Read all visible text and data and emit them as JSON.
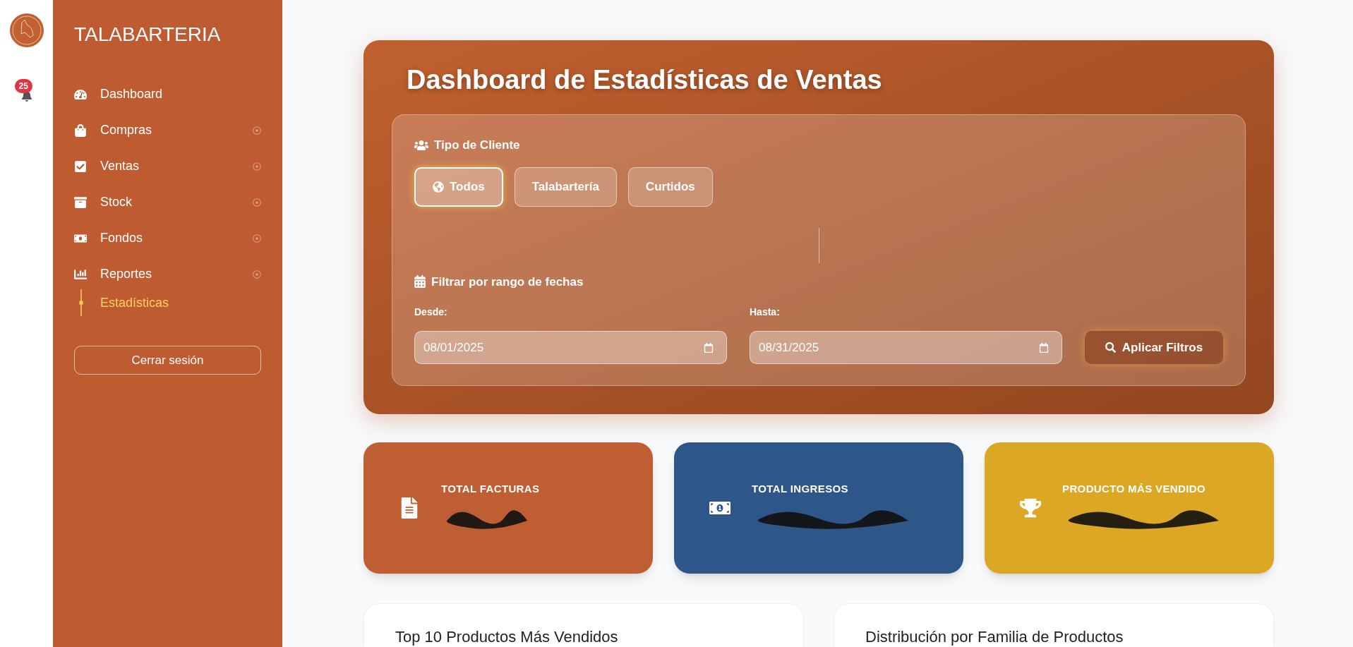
{
  "rail": {
    "notification_count": "25"
  },
  "sidebar": {
    "title": "TALABARTERIA",
    "items": [
      {
        "label": "Dashboard",
        "kind": "link",
        "selected": false
      },
      {
        "label": "Compras",
        "kind": "menu",
        "selected": false
      },
      {
        "label": "Ventas",
        "kind": "menu",
        "selected": false
      },
      {
        "label": "Stock",
        "kind": "menu",
        "selected": false
      },
      {
        "label": "Fondos",
        "kind": "menu",
        "selected": false
      },
      {
        "label": "Reportes",
        "kind": "menu",
        "selected": false,
        "children": [
          {
            "label": "Estadísticas",
            "selected": true
          }
        ]
      }
    ],
    "logout": "Cerrar sesión"
  },
  "header": {
    "title": "Dashboard de Estadísticas de Ventas",
    "client_type": {
      "label": "Tipo de Cliente",
      "options": [
        {
          "label": "Todos",
          "selected": true
        },
        {
          "label": "Talabartería",
          "selected": false
        },
        {
          "label": "Curtidos",
          "selected": false
        }
      ]
    },
    "date_filter": {
      "label": "Filtrar por rango de fechas",
      "from_label": "Desde:",
      "from_value": "08/01/2025",
      "to_label": "Hasta:",
      "to_value": "08/31/2025",
      "apply": "Aplicar Filtros"
    }
  },
  "stats": [
    {
      "label": "TOTAL FACTURAS",
      "color": "#c05e33"
    },
    {
      "label": "TOTAL INGRESOS",
      "color": "#2f5689"
    },
    {
      "label": "PRODUCTO MÁS VENDIDO",
      "color": "#dca724"
    }
  ],
  "panels": [
    {
      "title": "Top 10 Productos Más Vendidos"
    },
    {
      "title": "Distribución por Familia de Productos"
    }
  ]
}
